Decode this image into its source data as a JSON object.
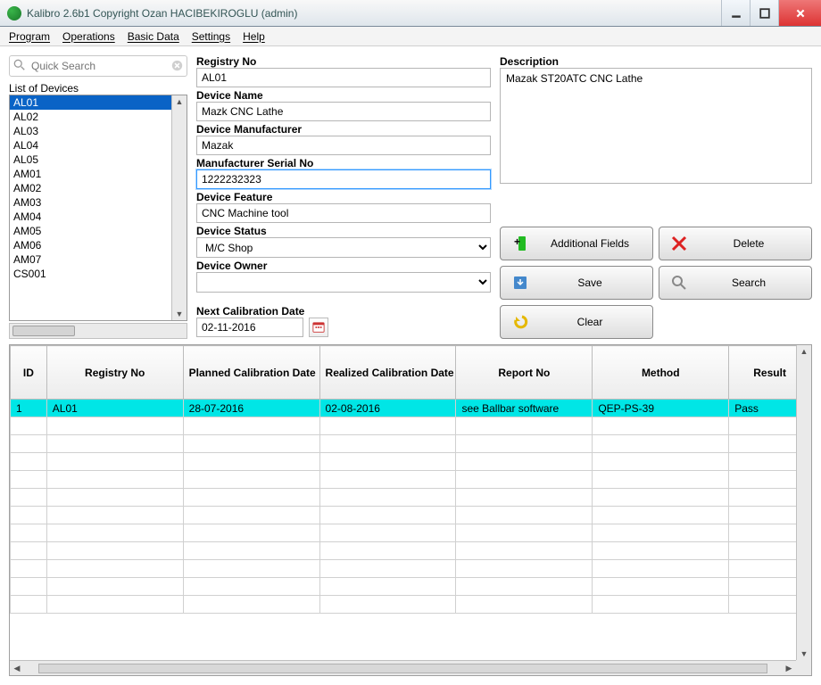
{
  "window": {
    "title": "Kalibro 2.6b1    Copyright Ozan HACIBEKIROGLU (admin)"
  },
  "menu": {
    "program": "Program",
    "operations": "Operations",
    "basic": "Basic Data",
    "settings": "Settings",
    "help": "Help"
  },
  "search": {
    "placeholder": "Quick Search"
  },
  "listLabel": "List of Devices",
  "devices": [
    "AL01",
    "AL02",
    "AL03",
    "AL04",
    "AL05",
    "AM01",
    "AM02",
    "AM03",
    "AM04",
    "AM05",
    "AM06",
    "AM07",
    "CS001"
  ],
  "fields": {
    "registryNo": {
      "label": "Registry No",
      "value": "AL01"
    },
    "deviceName": {
      "label": "Device Name",
      "value": "Mazk CNC Lathe"
    },
    "manufacturer": {
      "label": "Device Manufacturer",
      "value": "Mazak"
    },
    "serial": {
      "label": "Manufacturer Serial No",
      "value": "1222232323"
    },
    "feature": {
      "label": "Device Feature",
      "value": "CNC Machine tool"
    },
    "status": {
      "label": "Device Status",
      "value": "M/C Shop"
    },
    "owner": {
      "label": "Device Owner",
      "value": ""
    },
    "nextCal": {
      "label": "Next Calibration Date",
      "value": "02-11-2016"
    },
    "description": {
      "label": "Description",
      "value": "Mazak ST20ATC CNC Lathe"
    }
  },
  "buttons": {
    "additional": "Additional Fields",
    "delete": "Delete",
    "save": "Save",
    "search": "Search",
    "clear": "Clear"
  },
  "grid": {
    "columns": {
      "id": "ID",
      "registry": "Registry No",
      "planned": "Planned Calibration Date",
      "realized": "Realized Calibration Date",
      "report": "Report No",
      "method": "Method",
      "result": "Result"
    },
    "row": {
      "id": "1",
      "registry": "AL01",
      "planned": "28-07-2016",
      "realized": "02-08-2016",
      "report": "see Ballbar software",
      "method": "QEP-PS-39",
      "result": "Pass"
    }
  }
}
